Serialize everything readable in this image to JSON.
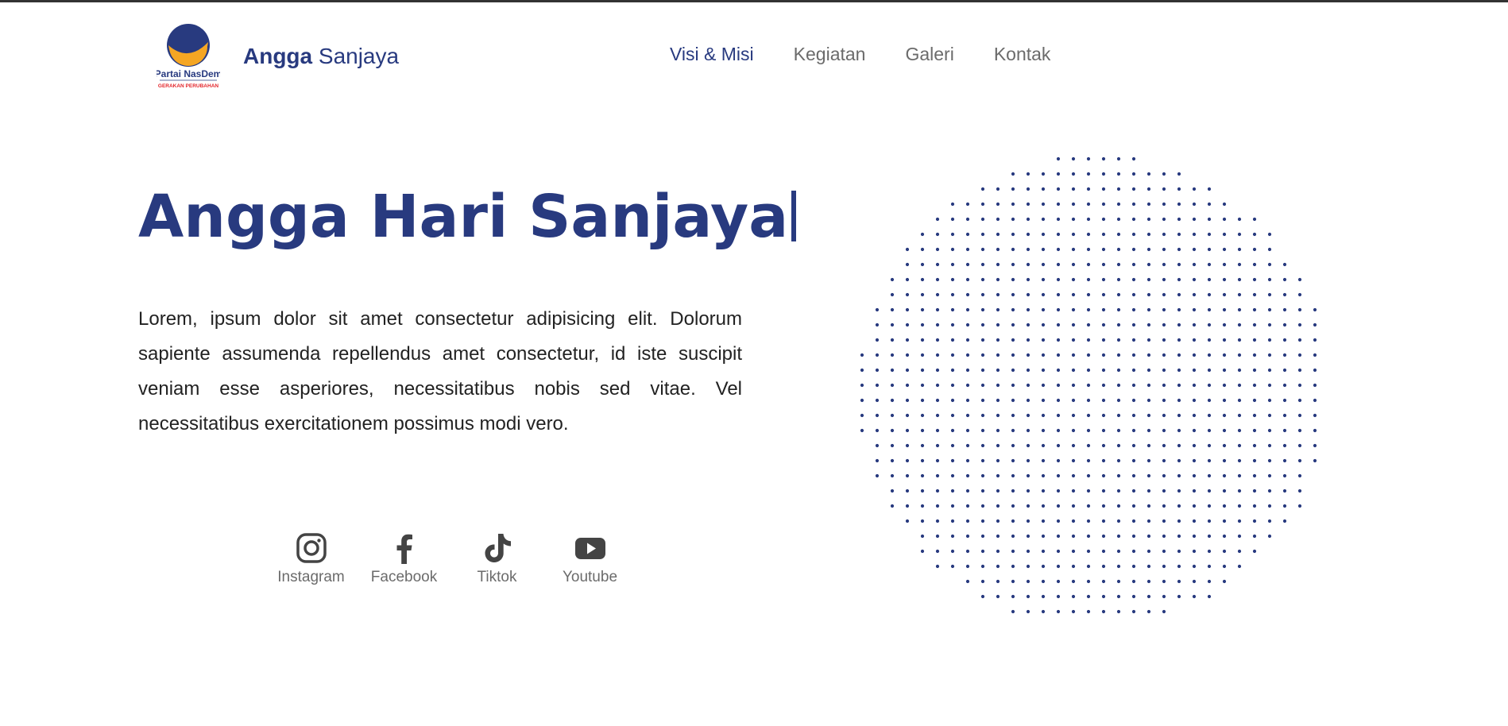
{
  "header": {
    "logo": {
      "line1": "Partai NasDem",
      "line2": "GERAKAN PERUBAHAN",
      "colors": {
        "navy": "#283a7f",
        "gold": "#f5a623",
        "red": "#e3262b"
      }
    },
    "brand": {
      "first": "Angga",
      "last": "Sanjaya"
    },
    "nav": [
      {
        "label": "Visi & Misi",
        "active": true
      },
      {
        "label": "Kegiatan",
        "active": false
      },
      {
        "label": "Galeri",
        "active": false
      },
      {
        "label": "Kontak",
        "active": false
      }
    ]
  },
  "hero": {
    "title": "Angga Hari Sanjaya",
    "text": "Lorem, ipsum dolor sit amet consectetur adipisicing elit. Dolorum sapiente assumenda repellendus amet consectetur, id iste suscipit veniam esse asperiores, necessitatibus nobis sed vitae. Vel necessitatibus exercitationem possimus modi vero."
  },
  "socials": [
    {
      "label": "Instagram",
      "icon": "instagram-icon"
    },
    {
      "label": "Facebook",
      "icon": "facebook-icon"
    },
    {
      "label": "Tiktok",
      "icon": "tiktok-icon"
    },
    {
      "label": "Youtube",
      "icon": "youtube-icon"
    }
  ],
  "colors": {
    "accent": "#283a7f",
    "muted": "#6b6b6b",
    "dot": "#283a7f"
  }
}
